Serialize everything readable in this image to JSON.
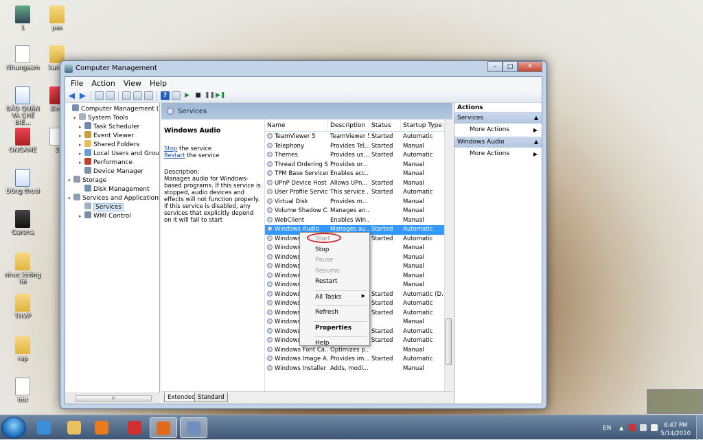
{
  "desktop": {
    "icons": [
      {
        "label": "1",
        "kind": "photo"
      },
      {
        "label": "pas",
        "kind": "folder"
      },
      {
        "label": "Nhungasm",
        "kind": "doc"
      },
      {
        "label": "karao",
        "kind": "folder"
      },
      {
        "label": "BẢO QUẢN VÀ CHẾ BIẾ...",
        "kind": "word"
      },
      {
        "label": "Zing",
        "kind": "app"
      },
      {
        "label": "ONGAME",
        "kind": "app"
      },
      {
        "label": "2",
        "kind": "doc"
      },
      {
        "label": "Đông thoai",
        "kind": "word"
      },
      {
        "label": "Garena",
        "kind": "game"
      },
      {
        "label": "nhac không lời",
        "kind": "folder"
      },
      {
        "label": "THVP",
        "kind": "folder"
      },
      {
        "label": "rap",
        "kind": "folder"
      },
      {
        "label": "bbt",
        "kind": "doc"
      }
    ]
  },
  "window": {
    "title": "Computer Management",
    "menu": [
      "File",
      "Action",
      "View",
      "Help"
    ]
  },
  "tree": {
    "items": [
      {
        "label": "Computer Management (Local)",
        "icon_color": "#7a8fb0"
      },
      {
        "label": "System Tools",
        "icon_color": "#a8b4c4"
      },
      {
        "label": "Task Scheduler",
        "icon_color": "#6e88b2"
      },
      {
        "label": "Event Viewer",
        "icon_color": "#c8a040"
      },
      {
        "label": "Shared Folders",
        "icon_color": "#e6c054"
      },
      {
        "label": "Local Users and Groups",
        "icon_color": "#6a9ad0"
      },
      {
        "label": "Performance",
        "icon_color": "#c04030"
      },
      {
        "label": "Device Manager",
        "icon_color": "#8090a8"
      },
      {
        "label": "Storage",
        "icon_color": "#909aa8"
      },
      {
        "label": "Disk Management",
        "icon_color": "#7890b0"
      },
      {
        "label": "Services and Applications",
        "icon_color": "#8aa0b8"
      },
      {
        "label": "Services",
        "icon_color": "#a0b0c8"
      },
      {
        "label": "WMI Control",
        "icon_color": "#7a8ca8"
      }
    ],
    "scroll_thumb": "III"
  },
  "center": {
    "header": "Services",
    "description": {
      "title": "Windows Audio",
      "stop_link": "Stop",
      "stop_rest": " the service",
      "restart_link": "Restart",
      "restart_rest": " the service",
      "label": "Description:",
      "text": "Manages audio for Windows-based programs.  If this service is stopped, audio devices and effects will not function properly.  If this service is disabled, any services that explicitly depend on it will fail to start"
    },
    "columns": [
      "Name",
      "Description",
      "Status",
      "Startup Type"
    ],
    "rows": [
      {
        "name": "TeamViewer 5",
        "desc": "TeamViewer 5",
        "status": "Started",
        "startup": "Automatic"
      },
      {
        "name": "Telephony",
        "desc": "Provides Tel...",
        "status": "Started",
        "startup": "Manual"
      },
      {
        "name": "Themes",
        "desc": "Provides us...",
        "status": "Started",
        "startup": "Automatic"
      },
      {
        "name": "Thread Ordering S...",
        "desc": "Provides or...",
        "status": "",
        "startup": "Manual"
      },
      {
        "name": "TPM Base Services",
        "desc": "Enables acc...",
        "status": "",
        "startup": "Manual"
      },
      {
        "name": "UPnP Device Host",
        "desc": "Allows UPn...",
        "status": "Started",
        "startup": "Manual"
      },
      {
        "name": "User Profile Service",
        "desc": "This service ...",
        "status": "Started",
        "startup": "Automatic"
      },
      {
        "name": "Virtual Disk",
        "desc": "Provides m...",
        "status": "",
        "startup": "Manual"
      },
      {
        "name": "Volume Shadow C...",
        "desc": "Manages an...",
        "status": "",
        "startup": "Manual"
      },
      {
        "name": "WebClient",
        "desc": "Enables Win...",
        "status": "",
        "startup": "Manual"
      },
      {
        "name": "Windows Audio",
        "desc": "Manages au...",
        "status": "Started",
        "startup": "Automatic"
      },
      {
        "name": "Windows",
        "desc": "",
        "status": "Started",
        "startup": "Automatic"
      },
      {
        "name": "Windows",
        "desc": "",
        "status": "",
        "startup": "Manual"
      },
      {
        "name": "Windows",
        "desc": "",
        "status": "",
        "startup": "Manual"
      },
      {
        "name": "Windows",
        "desc": "",
        "status": "",
        "startup": "Manual"
      },
      {
        "name": "Windows",
        "desc": "",
        "status": "",
        "startup": "Manual"
      },
      {
        "name": "Windows",
        "desc": "",
        "status": "",
        "startup": "Manual"
      },
      {
        "name": "Windows",
        "desc": "",
        "status": "Started",
        "startup": "Automatic (D..."
      },
      {
        "name": "Windows",
        "desc": "",
        "status": "Started",
        "startup": "Automatic"
      },
      {
        "name": "Windows",
        "desc": "",
        "status": "Started",
        "startup": "Automatic"
      },
      {
        "name": "Windows",
        "desc": "",
        "status": "",
        "startup": "Manual"
      },
      {
        "name": "Windows",
        "desc": "",
        "status": "Started",
        "startup": "Automatic"
      },
      {
        "name": "Windows",
        "desc": "",
        "status": "Started",
        "startup": "Automatic"
      },
      {
        "name": "Windows Font Ca...",
        "desc": "Optimizes p...",
        "status": "",
        "startup": "Manual"
      },
      {
        "name": "Windows Image A...",
        "desc": "Provides im...",
        "status": "Started",
        "startup": "Automatic"
      },
      {
        "name": "Windows Installer",
        "desc": "Adds, modi...",
        "status": "",
        "startup": "Manual"
      }
    ],
    "selected_row": 10,
    "tabs": [
      "Extended",
      "Standard"
    ]
  },
  "actions": {
    "title": "Actions",
    "sections": [
      {
        "header": "Services",
        "item": "More Actions"
      },
      {
        "header": "Windows Audio",
        "item": "More Actions"
      }
    ]
  },
  "context_menu": {
    "items": [
      {
        "label": "Start",
        "disabled": true
      },
      {
        "label": "Stop",
        "disabled": false
      },
      {
        "label": "Pause",
        "disabled": true
      },
      {
        "label": "Resume",
        "disabled": true
      },
      {
        "label": "Restart",
        "disabled": false
      },
      {
        "sep": true
      },
      {
        "label": "All Tasks",
        "disabled": false,
        "submenu": true
      },
      {
        "sep": true
      },
      {
        "label": "Refresh",
        "disabled": false
      },
      {
        "sep": true
      },
      {
        "label": "Properties",
        "disabled": false,
        "bold": true
      },
      {
        "sep": true
      },
      {
        "label": "Help",
        "disabled": false
      }
    ],
    "highlight_color": "#d71f1f"
  },
  "taskbar": {
    "apps": [
      {
        "name": "ie",
        "color": "#3b8fd8"
      },
      {
        "name": "explorer",
        "color": "#e8c060"
      },
      {
        "name": "media-player",
        "color": "#e87a20"
      },
      {
        "name": "unikey",
        "color": "#d03030"
      },
      {
        "name": "firefox",
        "color": "#e06a1a",
        "active": true
      },
      {
        "name": "computer-management",
        "color": "#6f8fc0",
        "active": true
      }
    ],
    "lang": "EN",
    "time": "6:47 PM",
    "date": "5/14/2010"
  },
  "colors": {
    "selection": "#3399ff",
    "link": "#1550b0"
  }
}
